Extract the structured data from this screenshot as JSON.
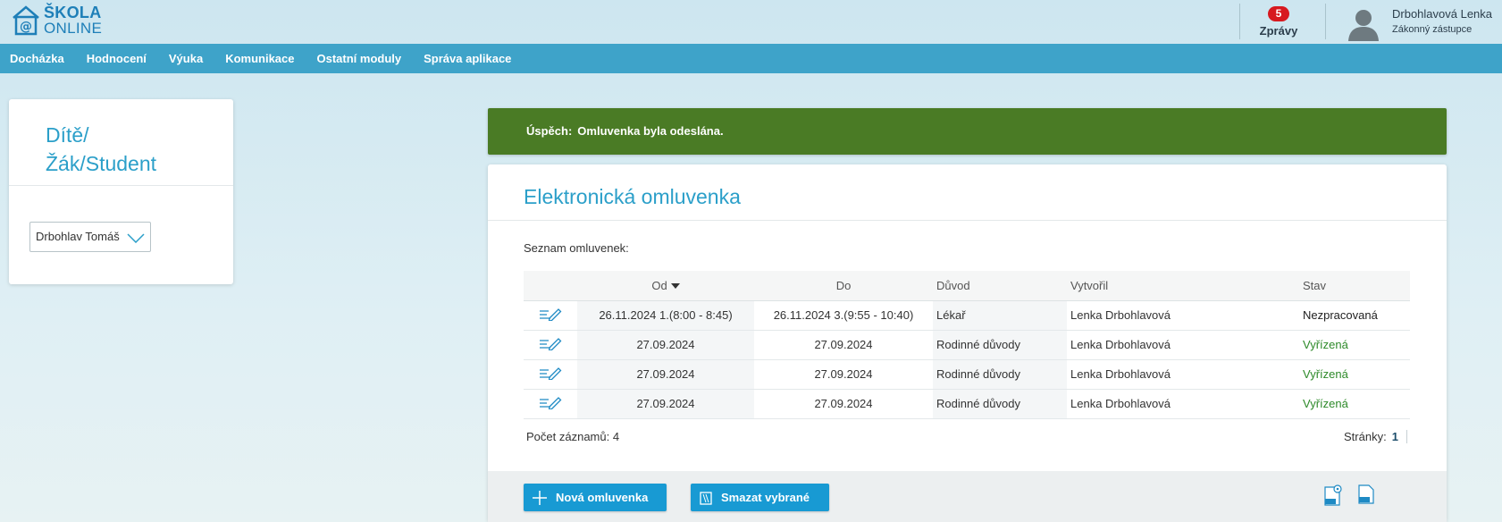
{
  "header": {
    "logo_line1": "ŠKOLA",
    "logo_line2": "ONLINE",
    "messages_count": "5",
    "messages_label": "Zprávy",
    "user_name": "Drbohlavová Lenka",
    "user_role": "Zákonný zástupce"
  },
  "nav": {
    "items": [
      "Docházka",
      "Hodnocení",
      "Výuka",
      "Komunikace",
      "Ostatní moduly",
      "Správa aplikace"
    ]
  },
  "left_panel": {
    "title_line1": "Dítě/",
    "title_line2": "Žák/Student",
    "selected_child": "Drbohlav Tomáš"
  },
  "alert": {
    "prefix": "Úspěch:",
    "message": "Omluvenka byla odeslána."
  },
  "main": {
    "title": "Elektronická omluvenka",
    "list_label": "Seznam omluvenek:",
    "columns": {
      "od": "Od",
      "do": "Do",
      "duvod": "Důvod",
      "vytvoril": "Vytvořil",
      "stav": "Stav"
    },
    "rows": [
      {
        "od": "26.11.2024 1.(8:00 - 8:45)",
        "do": "26.11.2024 3.(9:55 - 10:40)",
        "duvod": "Lékař",
        "vytvoril": "Lenka Drbohlavová",
        "stav": "Nezpracovaná"
      },
      {
        "od": "27.09.2024",
        "do": "27.09.2024",
        "duvod": "Rodinné důvody",
        "vytvoril": "Lenka Drbohlavová",
        "stav": "Vyřízená"
      },
      {
        "od": "27.09.2024",
        "do": "27.09.2024",
        "duvod": "Rodinné důvody",
        "vytvoril": "Lenka Drbohlavová",
        "stav": "Vyřízená"
      },
      {
        "od": "27.09.2024",
        "do": "27.09.2024",
        "duvod": "Rodinné důvody",
        "vytvoril": "Lenka Drbohlavová",
        "stav": "Vyřízená"
      }
    ],
    "count_label": "Počet záznamů: 4",
    "pages_label": "Stránky:",
    "pages_value": "1",
    "new_button": "Nová omluvenka",
    "delete_button": "Smazat vybrané"
  },
  "colors": {
    "nav_bg": "#3ea3c9",
    "accent": "#2b9fc9",
    "success_bg": "#4a7b25",
    "button_bg": "#189ad3",
    "status_done": "#2e8a2a",
    "badge": "#d7191f"
  },
  "icons": {
    "logo": "house-at-icon",
    "avatar": "user-silhouette-icon",
    "edit": "edit-pencil-icon",
    "plus": "plus-icon",
    "delete": "trash-icon",
    "export_settings": "xls-settings-icon",
    "export": "xls-export-icon"
  }
}
